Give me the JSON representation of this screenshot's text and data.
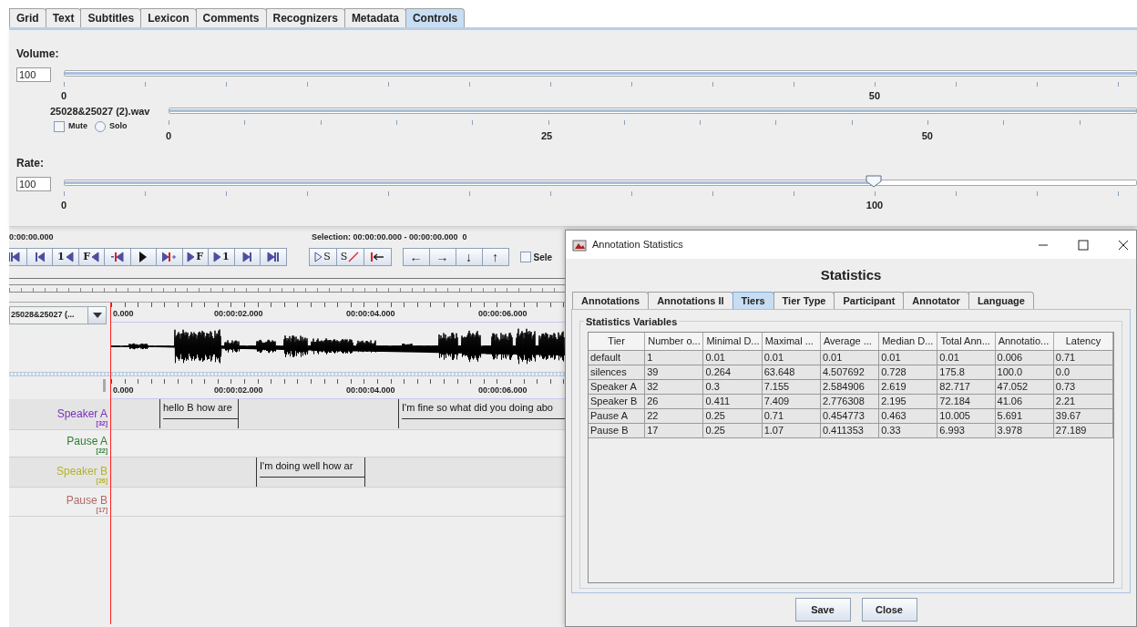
{
  "tabs": [
    {
      "label": "Grid",
      "selected": false
    },
    {
      "label": "Text",
      "selected": false
    },
    {
      "label": "Subtitles",
      "selected": false
    },
    {
      "label": "Lexicon",
      "selected": false
    },
    {
      "label": "Comments",
      "selected": false
    },
    {
      "label": "Recognizers",
      "selected": false
    },
    {
      "label": "Metadata",
      "selected": false
    },
    {
      "label": "Controls",
      "selected": true
    }
  ],
  "volume": {
    "label": "Volume:",
    "value": "100",
    "level": 1,
    "tick_labels": [
      "0",
      "50"
    ]
  },
  "media_slider": {
    "file": "25028&25027 (2).wav",
    "level": 1,
    "tick_labels": [
      "0",
      "25",
      "50"
    ],
    "mute": {
      "label": "Mute",
      "checked": false
    },
    "solo": {
      "label": "Solo",
      "selected": false
    }
  },
  "rate": {
    "label": "Rate:",
    "value": "100",
    "level": 0.755,
    "tick_labels": [
      "0",
      "100"
    ]
  },
  "player": {
    "time": "0:00:00.000",
    "selection": "Selection: 00:00:00.000 - 00:00:00.000  0",
    "playback_buttons": [
      {
        "kind": "begin"
      },
      {
        "kind": "prev"
      },
      {
        "kind": "label-back",
        "label": "1"
      },
      {
        "kind": "label-back",
        "label": "F"
      },
      {
        "kind": "mark-back"
      },
      {
        "kind": "play"
      },
      {
        "kind": "mark-fwd"
      },
      {
        "kind": "label-fwd",
        "label": "F"
      },
      {
        "kind": "label-fwd",
        "label": "1"
      },
      {
        "kind": "next"
      },
      {
        "kind": "end"
      }
    ],
    "selection_buttons": [
      {
        "kind": "play-selection",
        "label": "S"
      },
      {
        "kind": "clear-selection",
        "label": "S"
      },
      {
        "kind": "selection-begin"
      }
    ],
    "navigation_buttons": [
      {
        "kind": "arrow",
        "label": "←"
      },
      {
        "kind": "arrow",
        "label": "→"
      },
      {
        "kind": "arrow",
        "label": "↓"
      },
      {
        "kind": "arrow",
        "label": "↑"
      }
    ],
    "selection_checkbox": {
      "label": "Sele",
      "checked": false
    }
  },
  "waveform": {
    "track": "25028&25027 (...",
    "ruler_labels": [
      "0.000",
      "00:00:02.000",
      "00:00:04.000",
      "00:00:06.000"
    ]
  },
  "timeline": {
    "ruler_labels": [
      "0.000",
      "00:00:02.000",
      "00:00:04.000",
      "00:00:06.000"
    ],
    "tiers": [
      {
        "name": "Speaker A",
        "count": "[32]",
        "color": "#7b2fbe",
        "annotations": [
          "hello B how are",
          "I'm fine so what did you doing abo"
        ]
      },
      {
        "name": "Pause A",
        "count": "[22]",
        "color": "#2e7d32"
      },
      {
        "name": "Speaker B",
        "count": "[26]",
        "color": "#b3b328",
        "annotations": [
          "I'm doing well how ar"
        ]
      },
      {
        "name": "Pause B",
        "count": "[17]",
        "color": "#b06a6a"
      }
    ]
  },
  "dialog": {
    "title": "Annotation Statistics",
    "heading": "Statistics",
    "tabs": [
      {
        "label": "Annotations",
        "selected": false
      },
      {
        "label": "Annotations II",
        "selected": false
      },
      {
        "label": "Tiers",
        "selected": true
      },
      {
        "label": "Tier Type",
        "selected": false
      },
      {
        "label": "Participant",
        "selected": false
      },
      {
        "label": "Annotator",
        "selected": false
      },
      {
        "label": "Language",
        "selected": false
      }
    ],
    "group_label": "Statistics Variables",
    "table": {
      "columns": [
        "Tier",
        "Number o...",
        "Minimal D...",
        "Maximal ...",
        "Average ...",
        "Median D...",
        "Total Ann...",
        "Annotatio...",
        "Latency"
      ],
      "rows": [
        [
          "default",
          "1",
          "0.01",
          "0.01",
          "0.01",
          "0.01",
          "0.01",
          "0.006",
          "0.71"
        ],
        [
          "silences",
          "39",
          "0.264",
          "63.648",
          "4.507692",
          "0.728",
          "175.8",
          "100.0",
          "0.0"
        ],
        [
          "Speaker A",
          "32",
          "0.3",
          "7.155",
          "2.584906",
          "2.619",
          "82.717",
          "47.052",
          "0.73"
        ],
        [
          "Speaker B",
          "26",
          "0.411",
          "7.409",
          "2.776308",
          "2.195",
          "72.184",
          "41.06",
          "2.21"
        ],
        [
          "Pause A",
          "22",
          "0.25",
          "0.71",
          "0.454773",
          "0.463",
          "10.005",
          "5.691",
          "39.67"
        ],
        [
          "Pause B",
          "17",
          "0.25",
          "1.07",
          "0.411353",
          "0.33",
          "6.993",
          "3.978",
          "27.189"
        ]
      ]
    },
    "buttons": [
      "Save",
      "Close"
    ]
  }
}
